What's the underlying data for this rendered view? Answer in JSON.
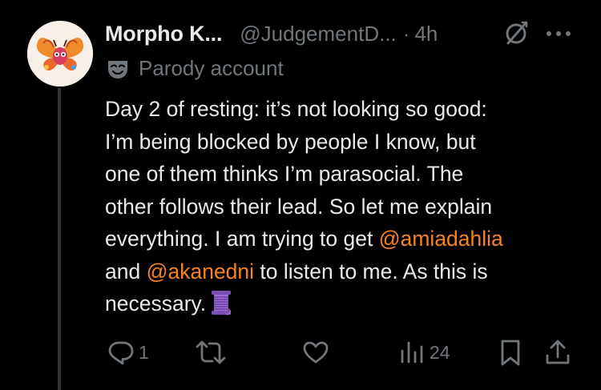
{
  "tweet": {
    "author_name": "Morpho K...",
    "handle": "@JudgementD...",
    "separator": "·",
    "time": "4h",
    "account_label": "Parody account",
    "body": {
      "line1": "Day 2 of resting: it’s not looking so good:",
      "line2": "I’m being blocked by people I know, but",
      "line3": "one of them thinks I’m parasocial. The",
      "line4": "other follows their lead. So let me explain",
      "line5_pre": "everything. I am trying to get ",
      "mention1": "@amiadahlia",
      "line6_pre": "and ",
      "mention2": "@akanedni",
      "line6_post": " to listen to me. As this is",
      "line7": "necessary."
    },
    "emoji": "thread-spool-emoji"
  },
  "actions": {
    "reply_count": "1",
    "views_count": "24"
  },
  "colors": {
    "background": "#000000",
    "text": "#e7e9ea",
    "secondary": "#71767b",
    "mention": "#f7831f",
    "thread_line": "#333639"
  },
  "icons": [
    "avatar-image",
    "sync-icon",
    "more-icon",
    "mask-icon",
    "reply-icon",
    "repost-icon",
    "like-icon",
    "views-icon",
    "bookmark-icon",
    "share-icon"
  ]
}
